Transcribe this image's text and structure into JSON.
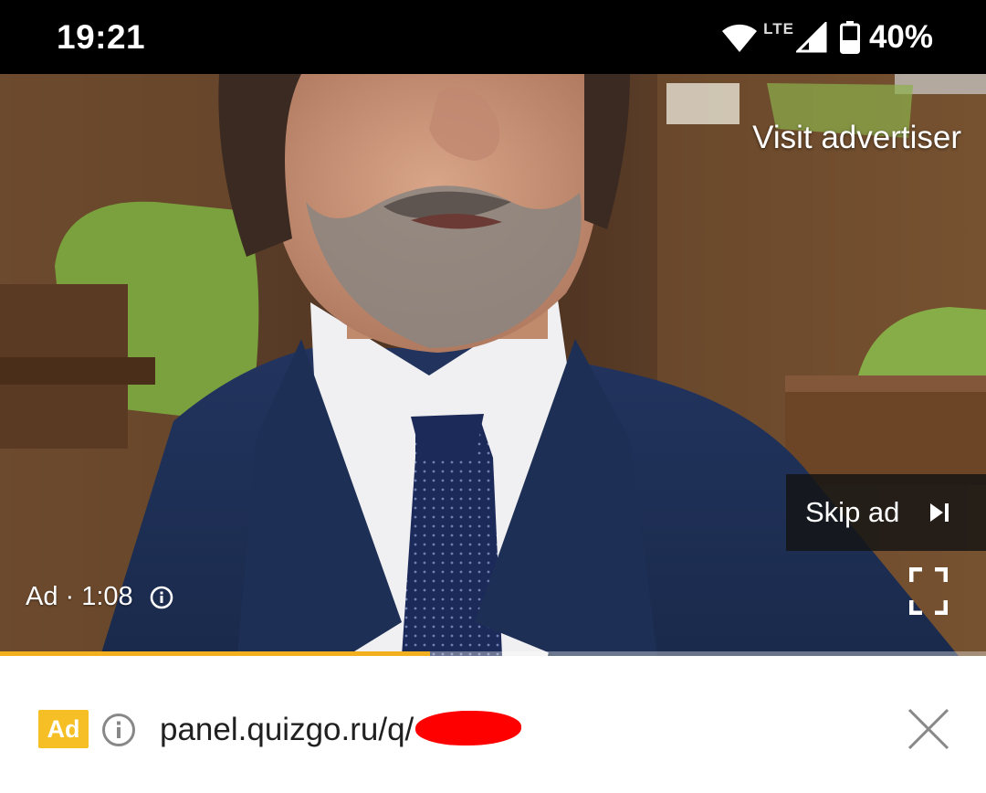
{
  "status_bar": {
    "time": "19:21",
    "network_label": "LTE",
    "battery_percent": "40%",
    "icons": [
      "wifi-icon",
      "cell-signal-icon",
      "battery-icon"
    ]
  },
  "video": {
    "visit_advertiser_label": "Visit advertiser",
    "skip_ad_label": "Skip ad",
    "ad_timer_label": "Ad · 1:08",
    "progress_fraction": 0.436,
    "progress_color": "#f2b01e",
    "icons": [
      "skip-next-icon",
      "info-icon",
      "fullscreen-icon"
    ]
  },
  "ad_banner": {
    "badge_label": "Ad",
    "badge_color": "#f6bf26",
    "url_text": "panel.quizgo.ru/q/",
    "url_redacted": true,
    "icons": [
      "info-icon",
      "close-icon"
    ]
  }
}
